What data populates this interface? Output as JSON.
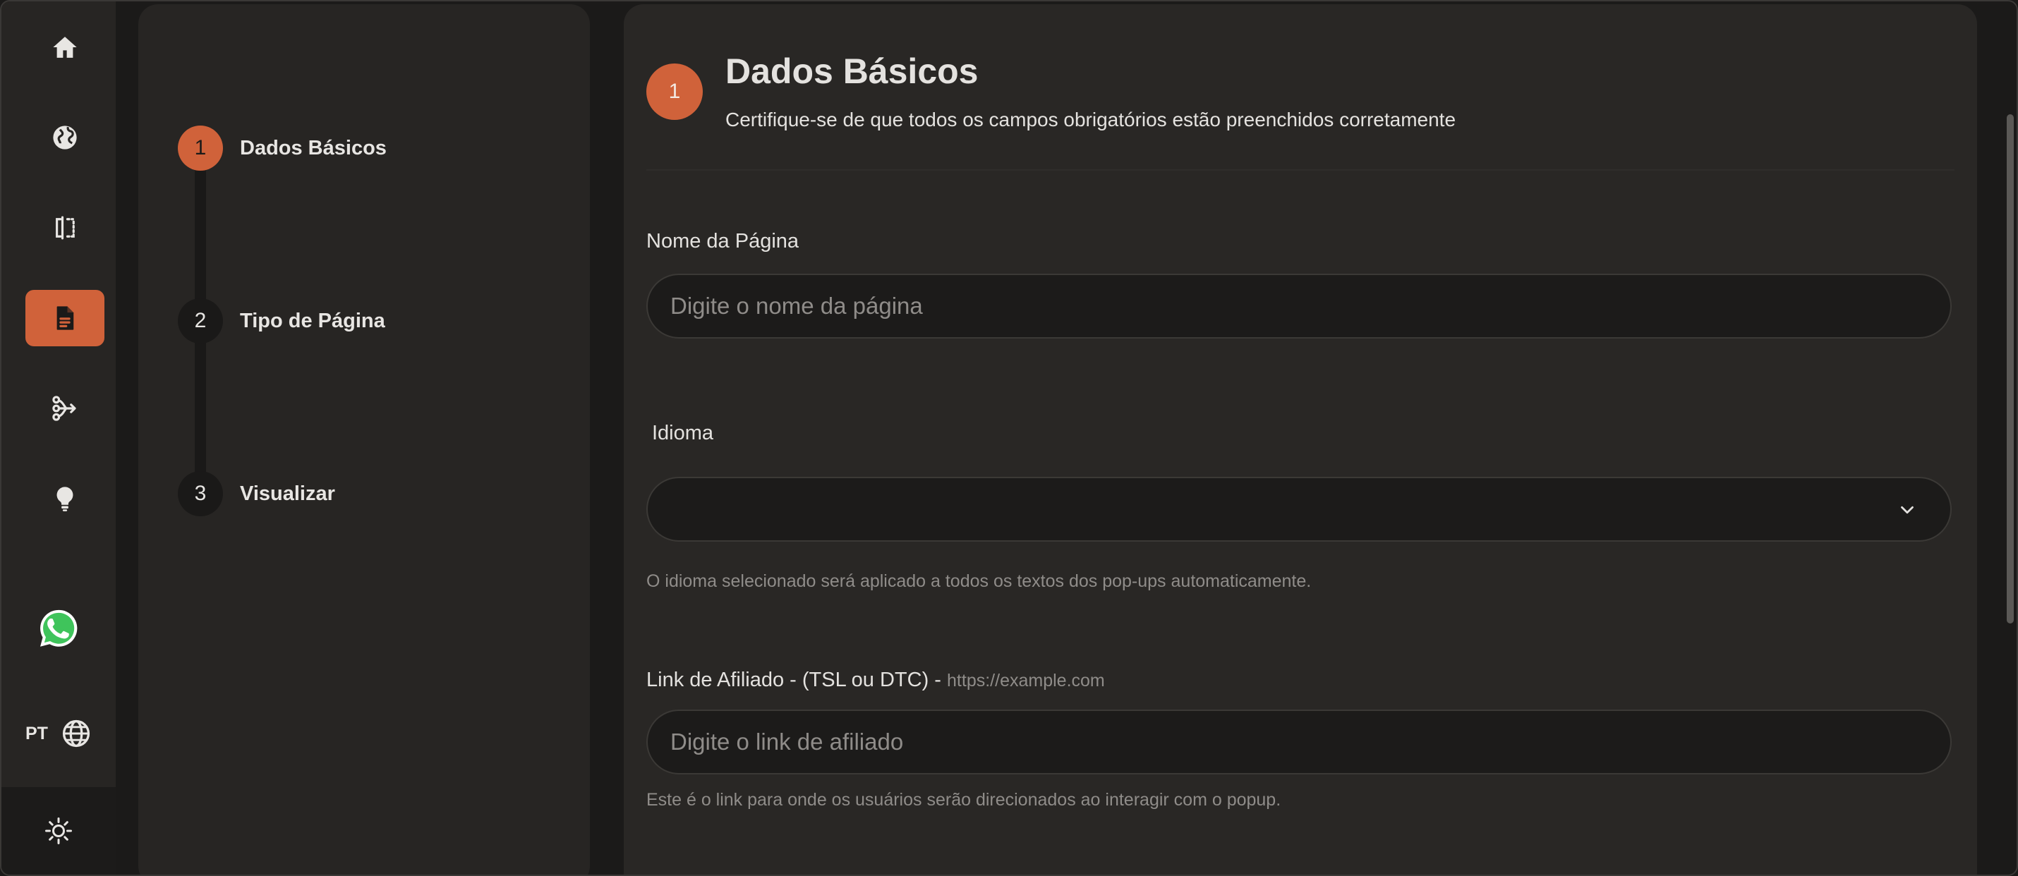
{
  "sidebar": {
    "items": [
      {
        "icon": "home-icon"
      },
      {
        "icon": "globe-icon"
      },
      {
        "icon": "compare-icon"
      },
      {
        "icon": "document-icon",
        "active": true
      },
      {
        "icon": "funnel-icon"
      },
      {
        "icon": "lightbulb-icon"
      }
    ],
    "whatsapp_icon": "whatsapp-icon",
    "language_code": "PT",
    "language_icon": "globe-icon",
    "theme_icon": "sun-icon",
    "accent_color": "#d0623a"
  },
  "stepper": {
    "steps": [
      {
        "number": "1",
        "label": "Dados Básicos",
        "active": true
      },
      {
        "number": "2",
        "label": "Tipo de Página"
      },
      {
        "number": "3",
        "label": "Visualizar"
      }
    ]
  },
  "form": {
    "step_number": "1",
    "title": "Dados Básicos",
    "subtitle": "Certifique-se de que todos os campos obrigatórios estão preenchidos corretamente",
    "page_name": {
      "label": "Nome da Página",
      "placeholder": "Digite o nome da página",
      "value": ""
    },
    "language": {
      "label": "Idioma",
      "value": "",
      "help": "O idioma selecionado será aplicado a todos os textos dos pop-ups automaticamente."
    },
    "affiliate_link": {
      "label": "Link de Afiliado - (TSL ou DTC) -",
      "example": "https://example.com",
      "placeholder": "Digite o link de afiliado",
      "value": "",
      "help": "Este é o link para onde os usuários serão direcionados ao interagir com o popup."
    }
  }
}
